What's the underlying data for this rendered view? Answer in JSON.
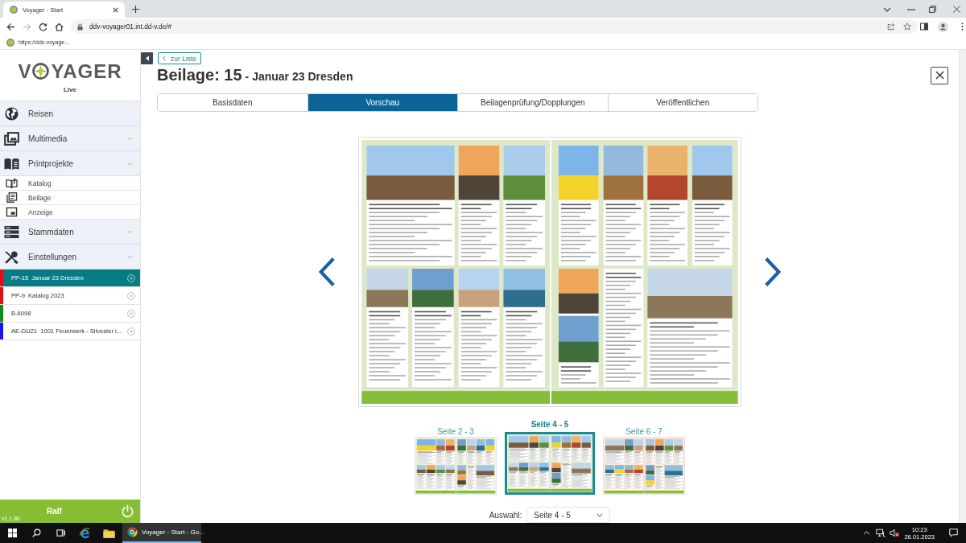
{
  "browser": {
    "tab_title": "Voyager - Start",
    "nav": [
      {
        "kind": "back",
        "disabled": false
      },
      {
        "kind": "forward",
        "disabled": true
      },
      {
        "kind": "reload",
        "disabled": false
      },
      {
        "kind": "home",
        "disabled": false
      }
    ],
    "url": "ddv-voyager01.int.dd-v.de/#",
    "bookmark": "https://ddv-voyage..."
  },
  "sidebar": {
    "logo": {
      "start": "V",
      "end": "YAGER"
    },
    "environment": "Live",
    "menu": [
      {
        "kind": "link",
        "label": "Reisen"
      },
      {
        "kind": "group",
        "label": "Multimedia",
        "expanded": false
      },
      {
        "kind": "group",
        "label": "Printprojekte",
        "expanded": true,
        "children": [
          {
            "label": "Katalog"
          },
          {
            "label": "Beilage"
          },
          {
            "label": "Anzeige"
          }
        ]
      },
      {
        "kind": "group",
        "label": "Stammdaten",
        "expanded": false
      },
      {
        "kind": "group",
        "label": "Einstellungen",
        "expanded": false
      }
    ],
    "projects": [
      {
        "code": "PP-15",
        "title": "Januar 23 Dresden",
        "selected": true,
        "color": "#e30f17"
      },
      {
        "code": "PP-9",
        "title": "Katalog 2023",
        "selected": false,
        "color": "#e30f17"
      },
      {
        "code": "B-6098",
        "selected": false,
        "color": "#118a1c"
      },
      {
        "code": "AE-DU21",
        "title": "1001 Feuerwerk - Silvester i...",
        "selected": false,
        "color": "#1a16e6"
      }
    ],
    "user": "Ralf",
    "version": "v1.1.80"
  },
  "main": {
    "back_link": "zur Liste",
    "title": "Beilage: 15",
    "subtitle": "- Januar 23 Dresden",
    "tabs": [
      {
        "label": "Basisdaten",
        "selected": false
      },
      {
        "label": "Vorschau",
        "selected": true
      },
      {
        "label": "Beilagenprüfung/Dopplungen",
        "selected": false
      },
      {
        "label": "Veröffentlichen",
        "selected": false
      }
    ],
    "thumbnails": [
      {
        "label": "Seite 2 - 3",
        "selected": false,
        "color": "#e1eacd"
      },
      {
        "label": "Seite 4 - 5",
        "selected": true,
        "color": "#dde8c6"
      },
      {
        "label": "Seite 6 - 7",
        "selected": false,
        "color": "#f6ddc2"
      }
    ],
    "selection": {
      "label": "Auswahl:",
      "value": "Seite 4 - 5"
    }
  },
  "taskbar": {
    "windows": [
      {
        "title": "Voyager - Start - Go...",
        "active": true
      }
    ],
    "time": "10:23",
    "date": "26.01.2023"
  }
}
